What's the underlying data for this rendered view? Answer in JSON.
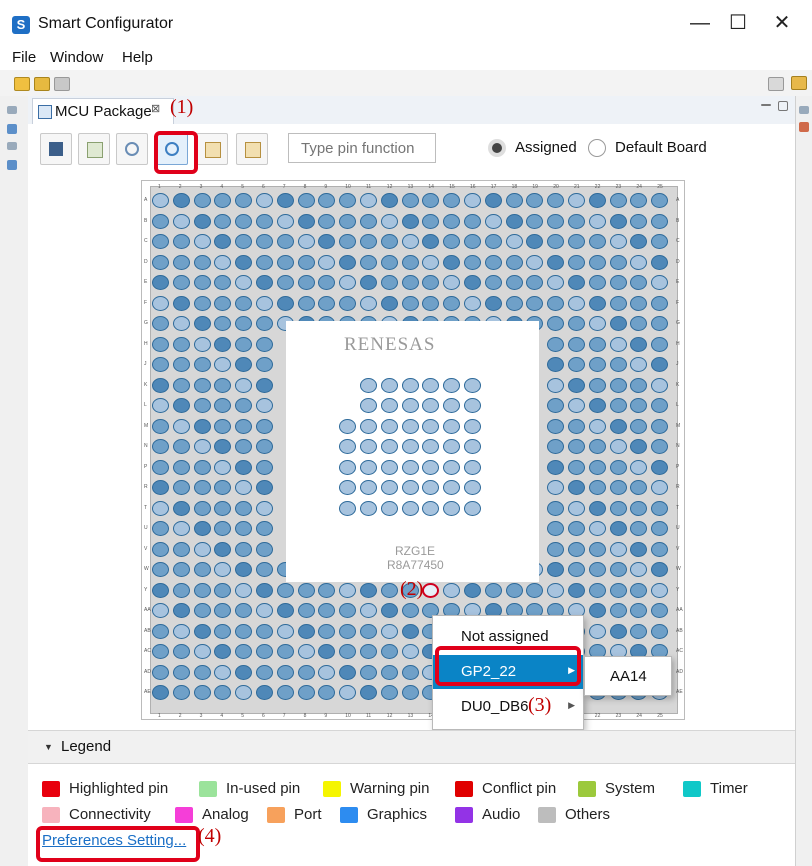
{
  "window": {
    "title": "Smart Configurator",
    "min_glyph": "—",
    "max_glyph": "☐",
    "close_glyph": "✕"
  },
  "menu": [
    "File",
    "Window",
    "Help"
  ],
  "tab": {
    "label": "MCU Package",
    "close_glyph": "⊠"
  },
  "markers": {
    "m1": "(1)",
    "m2": "(2)",
    "m3": "(3)",
    "m4": "(4)"
  },
  "toolbar": {
    "search_placeholder": "Type pin function",
    "radio_assigned": "Assigned",
    "radio_default": "Default Board",
    "buttons": [
      "save-icon",
      "pin-chart-icon",
      "zoom-out-icon",
      "zoom-in-icon",
      "export-icon",
      "import-icon"
    ]
  },
  "package": {
    "logo": "RENESAS",
    "chip_name": "RZG1E",
    "chip_part": "R8A77450",
    "columns": [
      "1",
      "2",
      "3",
      "4",
      "5",
      "6",
      "7",
      "8",
      "9",
      "10",
      "11",
      "12",
      "13",
      "14",
      "15",
      "16",
      "17",
      "18",
      "19",
      "20",
      "21",
      "22",
      "23",
      "24",
      "25"
    ],
    "rows": [
      "A",
      "B",
      "C",
      "D",
      "E",
      "F",
      "G",
      "H",
      "J",
      "K",
      "L",
      "M",
      "N",
      "P",
      "R",
      "T",
      "U",
      "V",
      "W",
      "Y",
      "AA",
      "AB",
      "AC",
      "AD",
      "AE"
    ]
  },
  "context_menu": {
    "items": [
      "Not assigned",
      "GP2_22",
      "DU0_DB6"
    ],
    "submenu_item": "AA14"
  },
  "legend": {
    "title": "Legend",
    "items": [
      {
        "label": "Highlighted pin",
        "color": "#e8000d"
      },
      {
        "label": "In-used pin",
        "color": "#9be39b"
      },
      {
        "label": "Warning pin",
        "color": "#f5f500"
      },
      {
        "label": "Conflict pin",
        "color": "#e00000"
      },
      {
        "label": "System",
        "color": "#9cc93c"
      },
      {
        "label": "Timer",
        "color": "#10c8c8"
      },
      {
        "label": "Connectivity",
        "color": "#f7b3bd"
      },
      {
        "label": "Analog",
        "color": "#f53ed8"
      },
      {
        "label": "Port",
        "color": "#f7a15c"
      },
      {
        "label": "Graphics",
        "color": "#2d8cf0"
      },
      {
        "label": "Audio",
        "color": "#9333e6"
      },
      {
        "label": "Others",
        "color": "#bdbdbd"
      }
    ],
    "preferences_link": "Preferences Setting..."
  }
}
